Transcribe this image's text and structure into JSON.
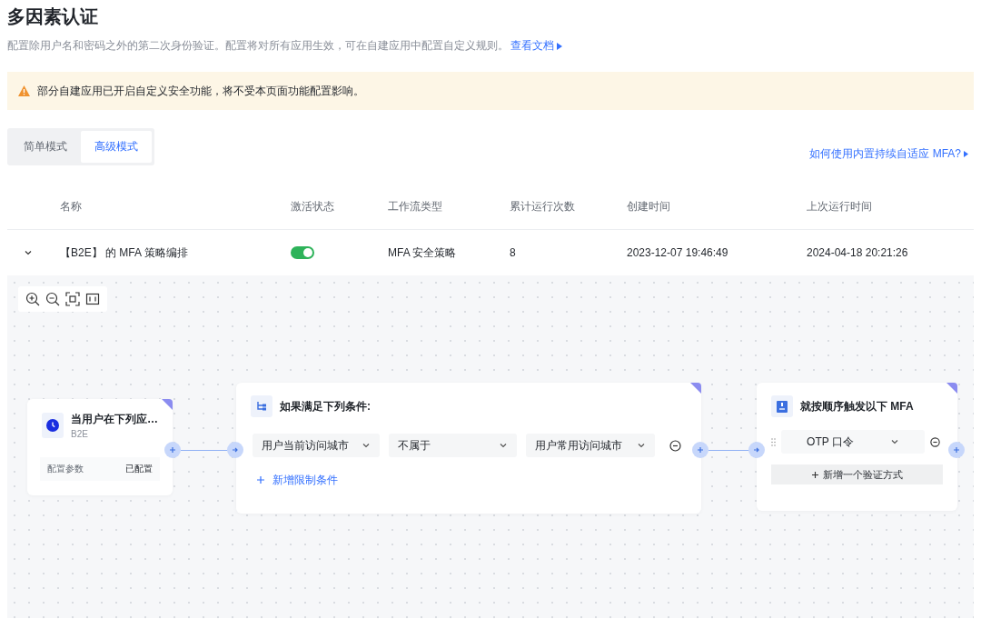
{
  "title": "多因素认证",
  "description": {
    "text": "配置除用户名和密码之外的第二次身份验证。配置将对所有应用生效，可在自建应用中配置自定义规则。",
    "link": "查看文档"
  },
  "alert": "部分自建应用已开启自定义安全功能，将不受本页面功能配置影响。",
  "mode_tabs": [
    {
      "label": "简单模式",
      "selected": false
    },
    {
      "label": "高级模式",
      "selected": true
    }
  ],
  "help_link": "如何使用内置持续自适应 MFA?",
  "table": {
    "columns": [
      "名称",
      "激活状态",
      "工作流类型",
      "累计运行次数",
      "创建时间",
      "上次运行时间"
    ],
    "rows": [
      {
        "expanded": true,
        "name": "【B2E】 的 MFA 策略编排",
        "active": true,
        "type": "MFA 安全策略",
        "runs": "8",
        "created": "2023-12-07 19:46:49",
        "last_run": "2024-04-18 20:21:26"
      }
    ]
  },
  "flow": {
    "trigger": {
      "title": "当用户在下列应…",
      "subtitle": "B2E",
      "param_label": "配置参数",
      "param_value": "已配置"
    },
    "condition": {
      "title": "如果满足下列条件:",
      "conditions": [
        {
          "field": "用户当前访问城市",
          "operator": "不属于",
          "value": "用户常用访问城市"
        }
      ],
      "add_label": "新增限制条件"
    },
    "action": {
      "title": "就按顺序触发以下 MFA",
      "methods": [
        {
          "label": "OTP 口令"
        }
      ],
      "add_label": "新增一个验证方式"
    }
  }
}
